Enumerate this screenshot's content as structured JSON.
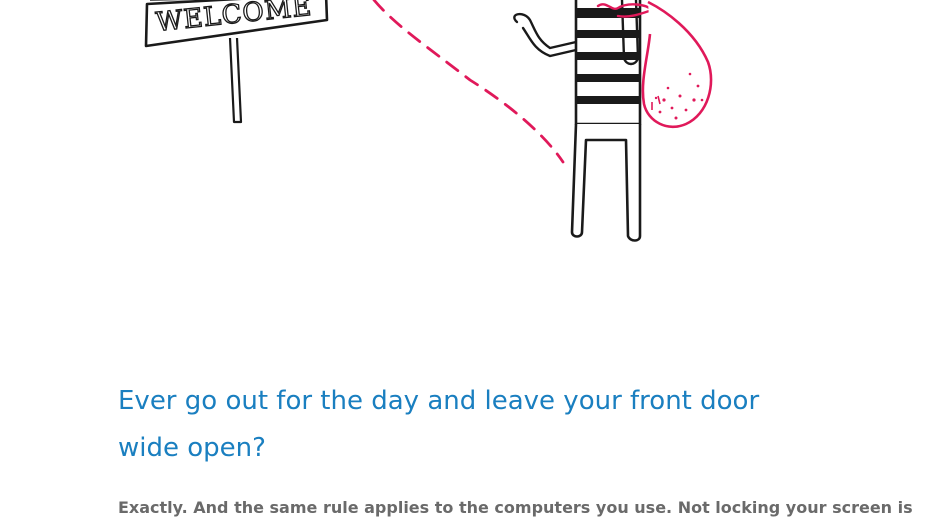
{
  "illustration": {
    "sign_text": "WELCOME",
    "colors": {
      "ink": "#1a1a1a",
      "accent": "#e0195a"
    }
  },
  "content": {
    "headline": "Ever go out for the day and leave your front door wide open?",
    "body": "Exactly. And the same rule applies to the computers you use. Not locking your screen is"
  },
  "colors": {
    "headline": "#1a7fc0",
    "body": "#6a6a6a",
    "background": "#ffffff"
  }
}
